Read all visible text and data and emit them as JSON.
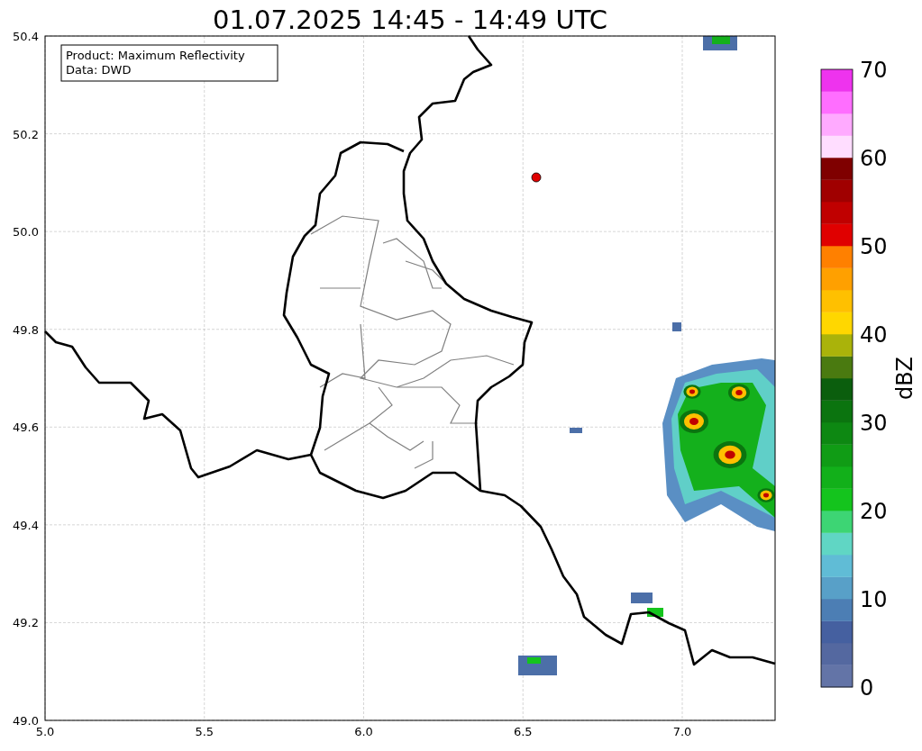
{
  "title": "01.07.2025 14:45 - 14:49 UTC",
  "map": {
    "xticks": [
      "5.0",
      "5.5",
      "6.0",
      "6.5",
      "7.0"
    ],
    "yticks": [
      "50.4",
      "50.2",
      "50.0",
      "49.8",
      "49.6",
      "49.4",
      "49.2",
      "49.0"
    ],
    "info_box": [
      "Product: Maximum Reflectivity",
      "Data: DWD"
    ]
  },
  "colorbar": {
    "label": "dBZ",
    "ticks": [
      "70",
      "60",
      "50",
      "40",
      "30",
      "20",
      "10",
      "0"
    ],
    "segments": [
      {
        "color": "#6374a7"
      },
      {
        "color": "#5468a0"
      },
      {
        "color": "#4560a0"
      },
      {
        "color": "#4c7eb4"
      },
      {
        "color": "#58a0c8"
      },
      {
        "color": "#60bcd6"
      },
      {
        "color": "#60d6c4"
      },
      {
        "color": "#3dd574"
      },
      {
        "color": "#14c41d"
      },
      {
        "color": "#12b01a"
      },
      {
        "color": "#109c15"
      },
      {
        "color": "#0d8812"
      },
      {
        "color": "#0b740f"
      },
      {
        "color": "#0b5e0d"
      },
      {
        "color": "#4a7a10"
      },
      {
        "color": "#aab30a"
      },
      {
        "color": "#ffd700"
      },
      {
        "color": "#ffc000"
      },
      {
        "color": "#ffa000"
      },
      {
        "color": "#ff8000"
      },
      {
        "color": "#e00000"
      },
      {
        "color": "#c00000"
      },
      {
        "color": "#a00000"
      },
      {
        "color": "#7f0000"
      },
      {
        "color": "#ffddff"
      },
      {
        "color": "#ffaaff"
      },
      {
        "color": "#ff6eff"
      },
      {
        "color": "#ee33ee"
      }
    ]
  }
}
